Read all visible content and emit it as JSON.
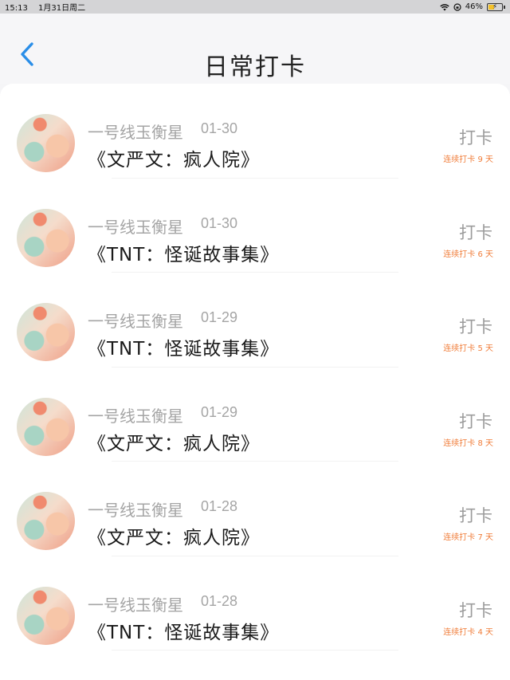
{
  "status_bar": {
    "time": "15:13",
    "date": "1月31日周二",
    "battery": "46%",
    "battery_level": 0.46,
    "battery_color": "#f4c22b",
    "icons": [
      "wifi-icon",
      "lock-rotation-icon",
      "battery-icon"
    ]
  },
  "nav": {
    "title": "日常打卡",
    "back_icon": "chevron-left-icon",
    "accent_color": "#2a8ee8"
  },
  "entries": [
    {
      "author": "一号线玉衡星",
      "date": "01-30",
      "book": "《文严文：疯人院》",
      "action": "打卡",
      "streak": "连续打卡 9 天"
    },
    {
      "author": "一号线玉衡星",
      "date": "01-30",
      "book": "《TNT：怪诞故事集》",
      "action": "打卡",
      "streak": "连续打卡 6 天"
    },
    {
      "author": "一号线玉衡星",
      "date": "01-29",
      "book": "《TNT：怪诞故事集》",
      "action": "打卡",
      "streak": "连续打卡 5 天"
    },
    {
      "author": "一号线玉衡星",
      "date": "01-29",
      "book": "《文严文：疯人院》",
      "action": "打卡",
      "streak": "连续打卡 8 天"
    },
    {
      "author": "一号线玉衡星",
      "date": "01-28",
      "book": "《文严文：疯人院》",
      "action": "打卡",
      "streak": "连续打卡 7 天"
    },
    {
      "author": "一号线玉衡星",
      "date": "01-28",
      "book": "《TNT：怪诞故事集》",
      "action": "打卡",
      "streak": "连续打卡 4 天"
    }
  ],
  "colors": {
    "streak": "#f07d3a",
    "secondary_text": "#a5a5a5"
  }
}
